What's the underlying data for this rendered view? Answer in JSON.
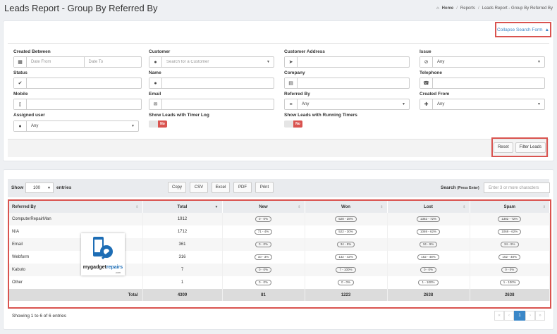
{
  "header": {
    "title": "Leads Report - Group By Referred By",
    "breadcrumb": [
      "Home",
      "Reports",
      "Leads Report - Group By Referred By"
    ]
  },
  "search_form": {
    "collapse_label": "Collapse Search Form",
    "fields": {
      "created_between": {
        "label": "Created Between",
        "from_placeholder": "Date From",
        "to_placeholder": "Date To"
      },
      "customer": {
        "label": "Customer",
        "placeholder": "Search for a Customer"
      },
      "customer_address": {
        "label": "Customer Address",
        "value": ""
      },
      "issue": {
        "label": "Issue",
        "value": "Any"
      },
      "status": {
        "label": "Status",
        "value": ""
      },
      "name": {
        "label": "Name",
        "value": ""
      },
      "company": {
        "label": "Company",
        "value": ""
      },
      "telephone": {
        "label": "Telephone",
        "value": ""
      },
      "mobile": {
        "label": "Mobile",
        "value": ""
      },
      "email": {
        "label": "Email",
        "value": ""
      },
      "referred_by": {
        "label": "Referred By",
        "value": "Any"
      },
      "created_from": {
        "label": "Created From",
        "value": "Any"
      },
      "assigned_user": {
        "label": "Assigned user",
        "value": "Any"
      },
      "timer_log": {
        "label": "Show Leads with Timer Log",
        "state": "No"
      },
      "running_timers": {
        "label": "Show Leads with Running Timers",
        "state": "No"
      }
    },
    "reset_label": "Reset",
    "filter_label": "Filter Leads"
  },
  "results": {
    "show_label": "Show",
    "page_size": "100",
    "entries_label": "entries",
    "export_buttons": [
      "Copy",
      "CSV",
      "Excel",
      "PDF",
      "Print"
    ],
    "search_label": "Search",
    "search_hint": "(Press Enter)",
    "search_placeholder": "Enter 3 or more characters",
    "columns": [
      "Referred By",
      "Total",
      "New",
      "Won",
      "Lost",
      "Spam"
    ],
    "rows": [
      {
        "referred_by": "ComputerRepairMan",
        "total": "1912",
        "new": "0 - 0%",
        "won": "528 - 28%",
        "lost": "1382 - 72%",
        "spam": "1382 - 72%"
      },
      {
        "referred_by": "N/A",
        "total": "1712",
        "new": "71 - 4%",
        "won": "522 - 30%",
        "lost": "1069 - 62%",
        "spam": "1069 - 62%"
      },
      {
        "referred_by": "Email",
        "total": "361",
        "new": "0 - 0%",
        "won": "34 - 9%",
        "lost": "34 - 9%",
        "spam": "34 - 9%"
      },
      {
        "referred_by": "Webform",
        "total": "316",
        "new": "10 - 3%",
        "won": "132 - 42%",
        "lost": "152 - 48%",
        "spam": "152 - 48%"
      },
      {
        "referred_by": "Kabuto",
        "total": "7",
        "new": "0 - 0%",
        "won": "7 - 100%",
        "lost": "0 - 0%",
        "spam": "0 - 0%"
      },
      {
        "referred_by": "Other",
        "total": "1",
        "new": "0 - 0%",
        "won": "0 - 0%",
        "lost": "1 - 100%",
        "spam": "1 - 100%"
      }
    ],
    "totals": {
      "label": "Total",
      "total": "4309",
      "new": "81",
      "won": "1223",
      "lost": "2638",
      "spam": "2638"
    },
    "showing_text": "Showing 1 to 6 of 6 entries",
    "pagination": [
      "«",
      "‹",
      "1",
      "›",
      "»"
    ],
    "current_page": "1"
  },
  "watermark": {
    "text_a": "mygadget",
    "text_b": "repairs",
    "suffix": ".com"
  }
}
